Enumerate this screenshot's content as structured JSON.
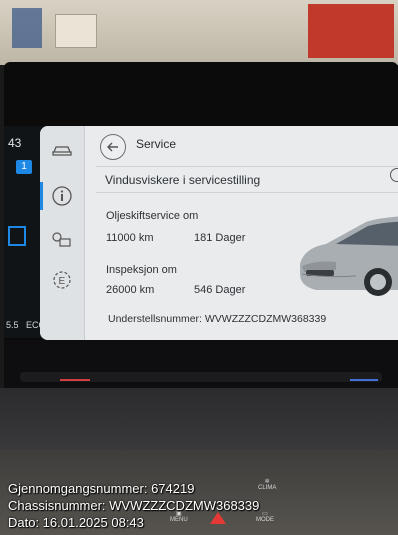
{
  "screen": {
    "title": "Service",
    "wiper_label": "Vindusviskere i servicestilling",
    "oil_service": {
      "heading": "Oljeskiftservice om",
      "distance": "11000 km",
      "days": "181 Dager"
    },
    "inspection": {
      "heading": "Inspeksjon om",
      "distance": "26000 km",
      "days": "546 Dager"
    },
    "chassis_line": "Understellsnummer: WVWZZZCDZMW368339"
  },
  "side_nav": [
    {
      "icon": "car-icon"
    },
    {
      "icon": "info-icon",
      "active": true
    },
    {
      "icon": "car-settings-icon"
    },
    {
      "icon": "e-mode-icon"
    }
  ],
  "left_cluster": {
    "temp": "43",
    "badge": "1",
    "val_left": "5.5",
    "eco": "ECO"
  },
  "dash_buttons": {
    "clima": "CLIMA",
    "menu": "MENU",
    "mode": "MODE"
  },
  "overlay": {
    "line1": "Gjennomgangsnummer: 674219",
    "line2": "Chassisnummer: WVWZZZCDZMW368339",
    "line3": "Dato: 16.01.2025 08:43"
  },
  "colors": {
    "accent": "#1e88e5",
    "panel_bg": "#e9ebed",
    "hazard": "#e53935"
  }
}
